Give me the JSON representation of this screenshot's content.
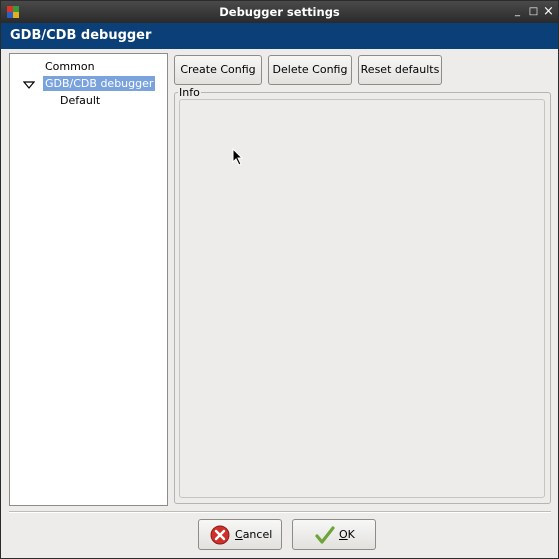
{
  "window": {
    "title": "Debugger settings",
    "controls": {
      "minimize": "_",
      "maximize": "□",
      "close": "×"
    }
  },
  "header": {
    "title": "GDB/CDB debugger"
  },
  "tree": {
    "items": [
      {
        "label": "Common",
        "level": 0,
        "selected": false
      },
      {
        "label": "GDB/CDB debugger",
        "level": 0,
        "selected": true,
        "expanded": true
      },
      {
        "label": "Default",
        "level": 1,
        "selected": false
      }
    ]
  },
  "toolbar": {
    "create_label": "Create Config",
    "delete_label": "Delete Config",
    "reset_label": "Reset defaults"
  },
  "info": {
    "label": "Info"
  },
  "dialog": {
    "cancel_label": "Cancel",
    "ok_label": "OK"
  },
  "colors": {
    "header_bg": "#0b3f78",
    "selection_bg": "#7aa3de",
    "window_bg": "#edecea"
  }
}
